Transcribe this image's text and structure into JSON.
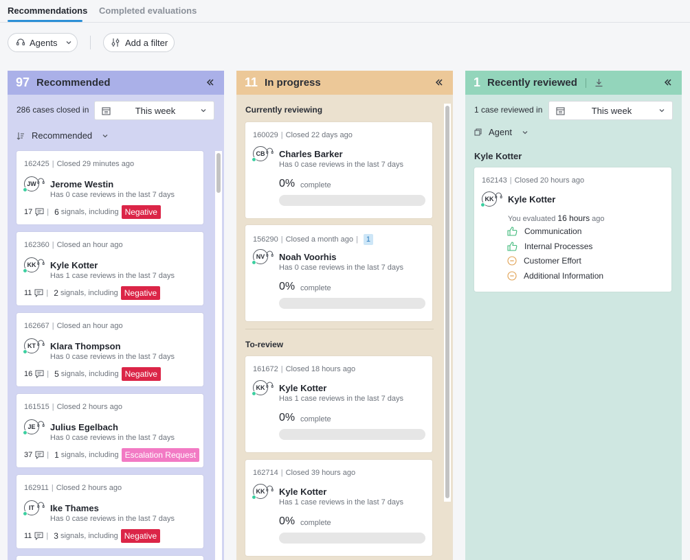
{
  "tabs": [
    {
      "label": "Recommendations",
      "active": true
    },
    {
      "label": "Completed evaluations",
      "active": false
    }
  ],
  "filters": {
    "agents_label": "Agents",
    "add_filter_label": "Add a filter"
  },
  "colors": {
    "accent": "#2b8fd6",
    "negative": "#db2547",
    "escalation": "#f27ac4",
    "online": "#3ccfa0"
  },
  "recommended": {
    "count": "97",
    "title": "Recommended",
    "cases_closed_text": "286 cases closed in",
    "period": "This week",
    "sort_label": "Recommended",
    "cards": [
      {
        "id": "162425",
        "closed": "Closed 29 minutes ago",
        "initials": "JW",
        "name": "Jerome Westin",
        "reviews": "Has 0 case reviews in the last 7 days",
        "comments": "17",
        "signals": "6",
        "signals_text": "signals, including",
        "tag": "Negative",
        "tag_type": "neg"
      },
      {
        "id": "162360",
        "closed": "Closed an hour ago",
        "initials": "KK",
        "name": "Kyle Kotter",
        "reviews": "Has 1 case reviews in the last 7 days",
        "comments": "11",
        "signals": "2",
        "signals_text": "signals, including",
        "tag": "Negative",
        "tag_type": "neg"
      },
      {
        "id": "162667",
        "closed": "Closed an hour ago",
        "initials": "KT",
        "name": "Klara Thompson",
        "reviews": "Has 0 case reviews in the last 7 days",
        "comments": "16",
        "signals": "5",
        "signals_text": "signals, including",
        "tag": "Negative",
        "tag_type": "neg"
      },
      {
        "id": "161515",
        "closed": "Closed 2 hours ago",
        "initials": "JE",
        "name": "Julius Egelbach",
        "reviews": "Has 0 case reviews in the last 7 days",
        "comments": "37",
        "signals": "1",
        "signals_text": "signals, including",
        "tag": "Escalation Request",
        "tag_type": "esc"
      },
      {
        "id": "162911",
        "closed": "Closed 2 hours ago",
        "initials": "IT",
        "name": "Ike Thames",
        "reviews": "Has 0 case reviews in the last 7 days",
        "comments": "11",
        "signals": "3",
        "signals_text": "signals, including",
        "tag": "Negative",
        "tag_type": "neg"
      }
    ]
  },
  "in_progress": {
    "count": "11",
    "title": "In progress",
    "currently_reviewing_title": "Currently reviewing",
    "to_review_title": "To-review",
    "complete_label": "complete",
    "reviewing_cards": [
      {
        "id": "160029",
        "closed": "Closed 22 days ago",
        "initials": "CB",
        "name": "Charles Barker",
        "reviews": "Has 0 case reviews in the last 7 days",
        "pct": "0%",
        "progress": 0,
        "badge": ""
      },
      {
        "id": "156290",
        "closed": "Closed a month ago",
        "initials": "NV",
        "name": "Noah Voorhis",
        "reviews": "Has 0 case reviews in the last 7 days",
        "pct": "0%",
        "progress": 0,
        "badge": "1"
      }
    ],
    "to_review_cards": [
      {
        "id": "161672",
        "closed": "Closed 18 hours ago",
        "initials": "KK",
        "name": "Kyle Kotter",
        "reviews": "Has 1 case reviews in the last 7 days",
        "pct": "0%",
        "progress": 0
      },
      {
        "id": "162714",
        "closed": "Closed 39 hours ago",
        "initials": "KK",
        "name": "Kyle Kotter",
        "reviews": "Has 1 case reviews in the last 7 days",
        "pct": "0%",
        "progress": 0
      }
    ]
  },
  "recently_reviewed": {
    "count": "1",
    "title": "Recently reviewed",
    "cases_reviewed_text": "1 case reviewed in",
    "period": "This week",
    "group_label": "Agent",
    "group_name": "Kyle Kotter",
    "card": {
      "id": "162143",
      "closed": "Closed 20 hours ago",
      "initials": "KK",
      "name": "Kyle Kotter",
      "evaluated_prefix": "You evaluated",
      "evaluated_time": "16 hours",
      "evaluated_suffix": "ago",
      "items": [
        {
          "label": "Communication",
          "icon": "thumbs-up-icon"
        },
        {
          "label": "Internal Processes",
          "icon": "thumbs-up-icon"
        },
        {
          "label": "Customer Effort",
          "icon": "neutral-icon"
        },
        {
          "label": "Additional Information",
          "icon": "neutral-icon"
        }
      ]
    }
  }
}
